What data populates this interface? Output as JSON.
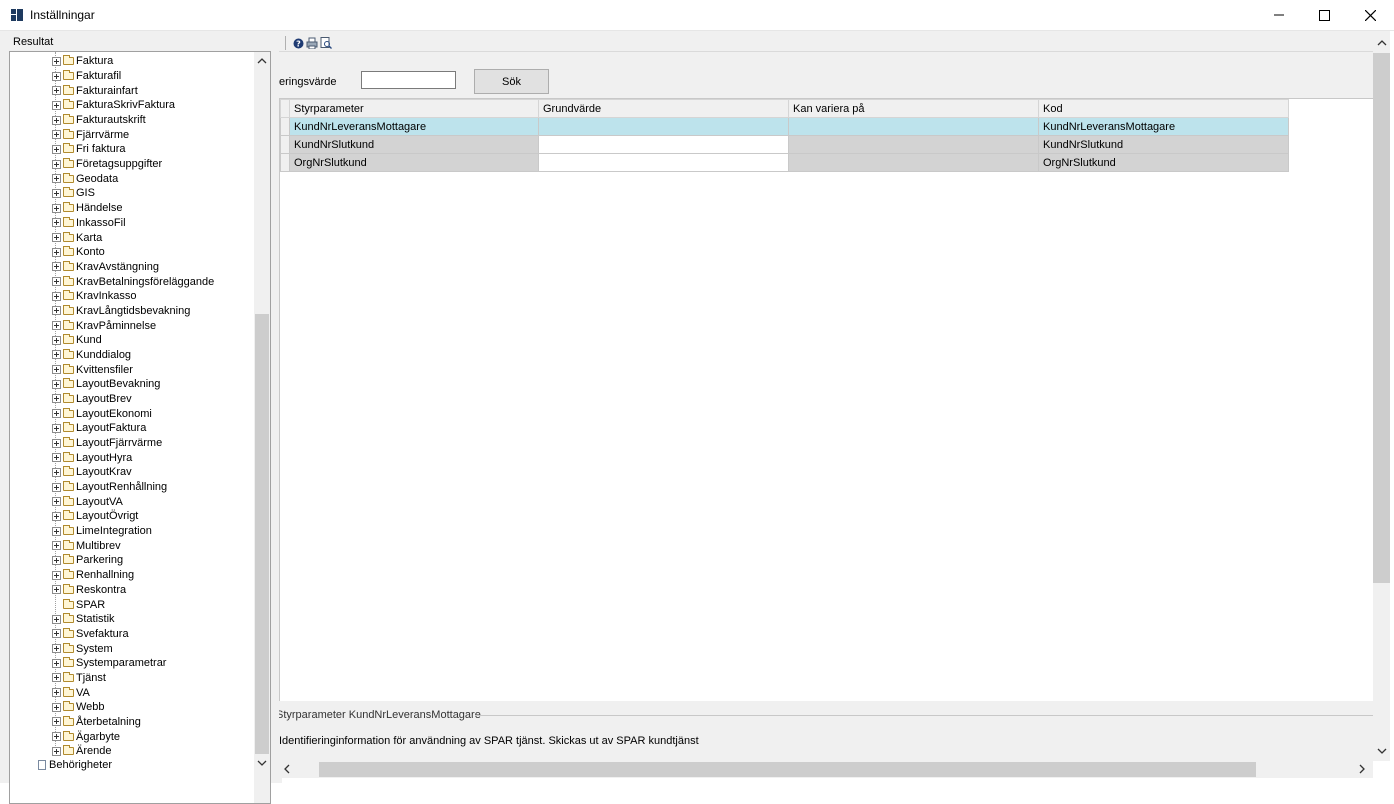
{
  "window": {
    "title": "Inställningar"
  },
  "left": {
    "label": "Resultat",
    "items": [
      {
        "label": "Faktura",
        "expandable": true
      },
      {
        "label": "Fakturafil",
        "expandable": true
      },
      {
        "label": "Fakturainfart",
        "expandable": true
      },
      {
        "label": "FakturaSkrivFaktura",
        "expandable": true
      },
      {
        "label": "Fakturautskrift",
        "expandable": true
      },
      {
        "label": "Fjärrvärme",
        "expandable": true
      },
      {
        "label": "Fri faktura",
        "expandable": true
      },
      {
        "label": "Företagsuppgifter",
        "expandable": true
      },
      {
        "label": "Geodata",
        "expandable": true
      },
      {
        "label": "GIS",
        "expandable": true
      },
      {
        "label": "Händelse",
        "expandable": true
      },
      {
        "label": "InkassoFil",
        "expandable": true
      },
      {
        "label": "Karta",
        "expandable": true
      },
      {
        "label": "Konto",
        "expandable": true
      },
      {
        "label": "KravAvstängning",
        "expandable": true
      },
      {
        "label": "KravBetalningsföreläggande",
        "expandable": true
      },
      {
        "label": "KravInkasso",
        "expandable": true
      },
      {
        "label": "KravLångtidsbevakning",
        "expandable": true
      },
      {
        "label": "KravPåminnelse",
        "expandable": true
      },
      {
        "label": "Kund",
        "expandable": true
      },
      {
        "label": "Kunddialog",
        "expandable": true
      },
      {
        "label": "Kvittensfiler",
        "expandable": true
      },
      {
        "label": "LayoutBevakning",
        "expandable": true
      },
      {
        "label": "LayoutBrev",
        "expandable": true
      },
      {
        "label": "LayoutEkonomi",
        "expandable": true
      },
      {
        "label": "LayoutFaktura",
        "expandable": true
      },
      {
        "label": "LayoutFjärrvärme",
        "expandable": true
      },
      {
        "label": "LayoutHyra",
        "expandable": true
      },
      {
        "label": "LayoutKrav",
        "expandable": true
      },
      {
        "label": "LayoutRenhållning",
        "expandable": true
      },
      {
        "label": "LayoutVA",
        "expandable": true
      },
      {
        "label": "LayoutÖvrigt",
        "expandable": true
      },
      {
        "label": "LimeIntegration",
        "expandable": true
      },
      {
        "label": "Multibrev",
        "expandable": true
      },
      {
        "label": "Parkering",
        "expandable": true
      },
      {
        "label": "Renhallning",
        "expandable": true
      },
      {
        "label": "Reskontra",
        "expandable": true
      },
      {
        "label": "SPAR",
        "expandable": false
      },
      {
        "label": "Statistik",
        "expandable": true
      },
      {
        "label": "Svefaktura",
        "expandable": true
      },
      {
        "label": "System",
        "expandable": true
      },
      {
        "label": "Systemparametrar",
        "expandable": true
      },
      {
        "label": "Tjänst",
        "expandable": true
      },
      {
        "label": "VA",
        "expandable": true
      },
      {
        "label": "Webb",
        "expandable": true
      },
      {
        "label": "Återbetalning",
        "expandable": true
      },
      {
        "label": "Ägarbyte",
        "expandable": true
      },
      {
        "label": "Ärende",
        "expandable": true
      }
    ],
    "root_item": "Behörigheter"
  },
  "search": {
    "label": "eringsvärde",
    "value": "",
    "button": "Sök"
  },
  "grid": {
    "columns": [
      "Styrparameter",
      "Grundvärde",
      "Kan variera på",
      "Kod"
    ],
    "rows": [
      {
        "styrparameter": "KundNrLeveransMottagare",
        "grundvarde": "",
        "kan_variera": "",
        "kod": "KundNrLeveransMottagare"
      },
      {
        "styrparameter": "KundNrSlutkund",
        "grundvarde": "",
        "kan_variera": "",
        "kod": "KundNrSlutkund"
      },
      {
        "styrparameter": "OrgNrSlutkund",
        "grundvarde": "",
        "kan_variera": "",
        "kod": "OrgNrSlutkund"
      }
    ]
  },
  "description": {
    "title": "Styrparameter KundNrLeveransMottagare",
    "text": "Identifieringinformation för användning av SPAR tjänst. Skickas ut av SPAR kundtjänst"
  },
  "colors": {
    "selected_row": "#bde3ec",
    "readonly_cell": "#d3d3d3",
    "panel_background": "#f0f0f0"
  }
}
